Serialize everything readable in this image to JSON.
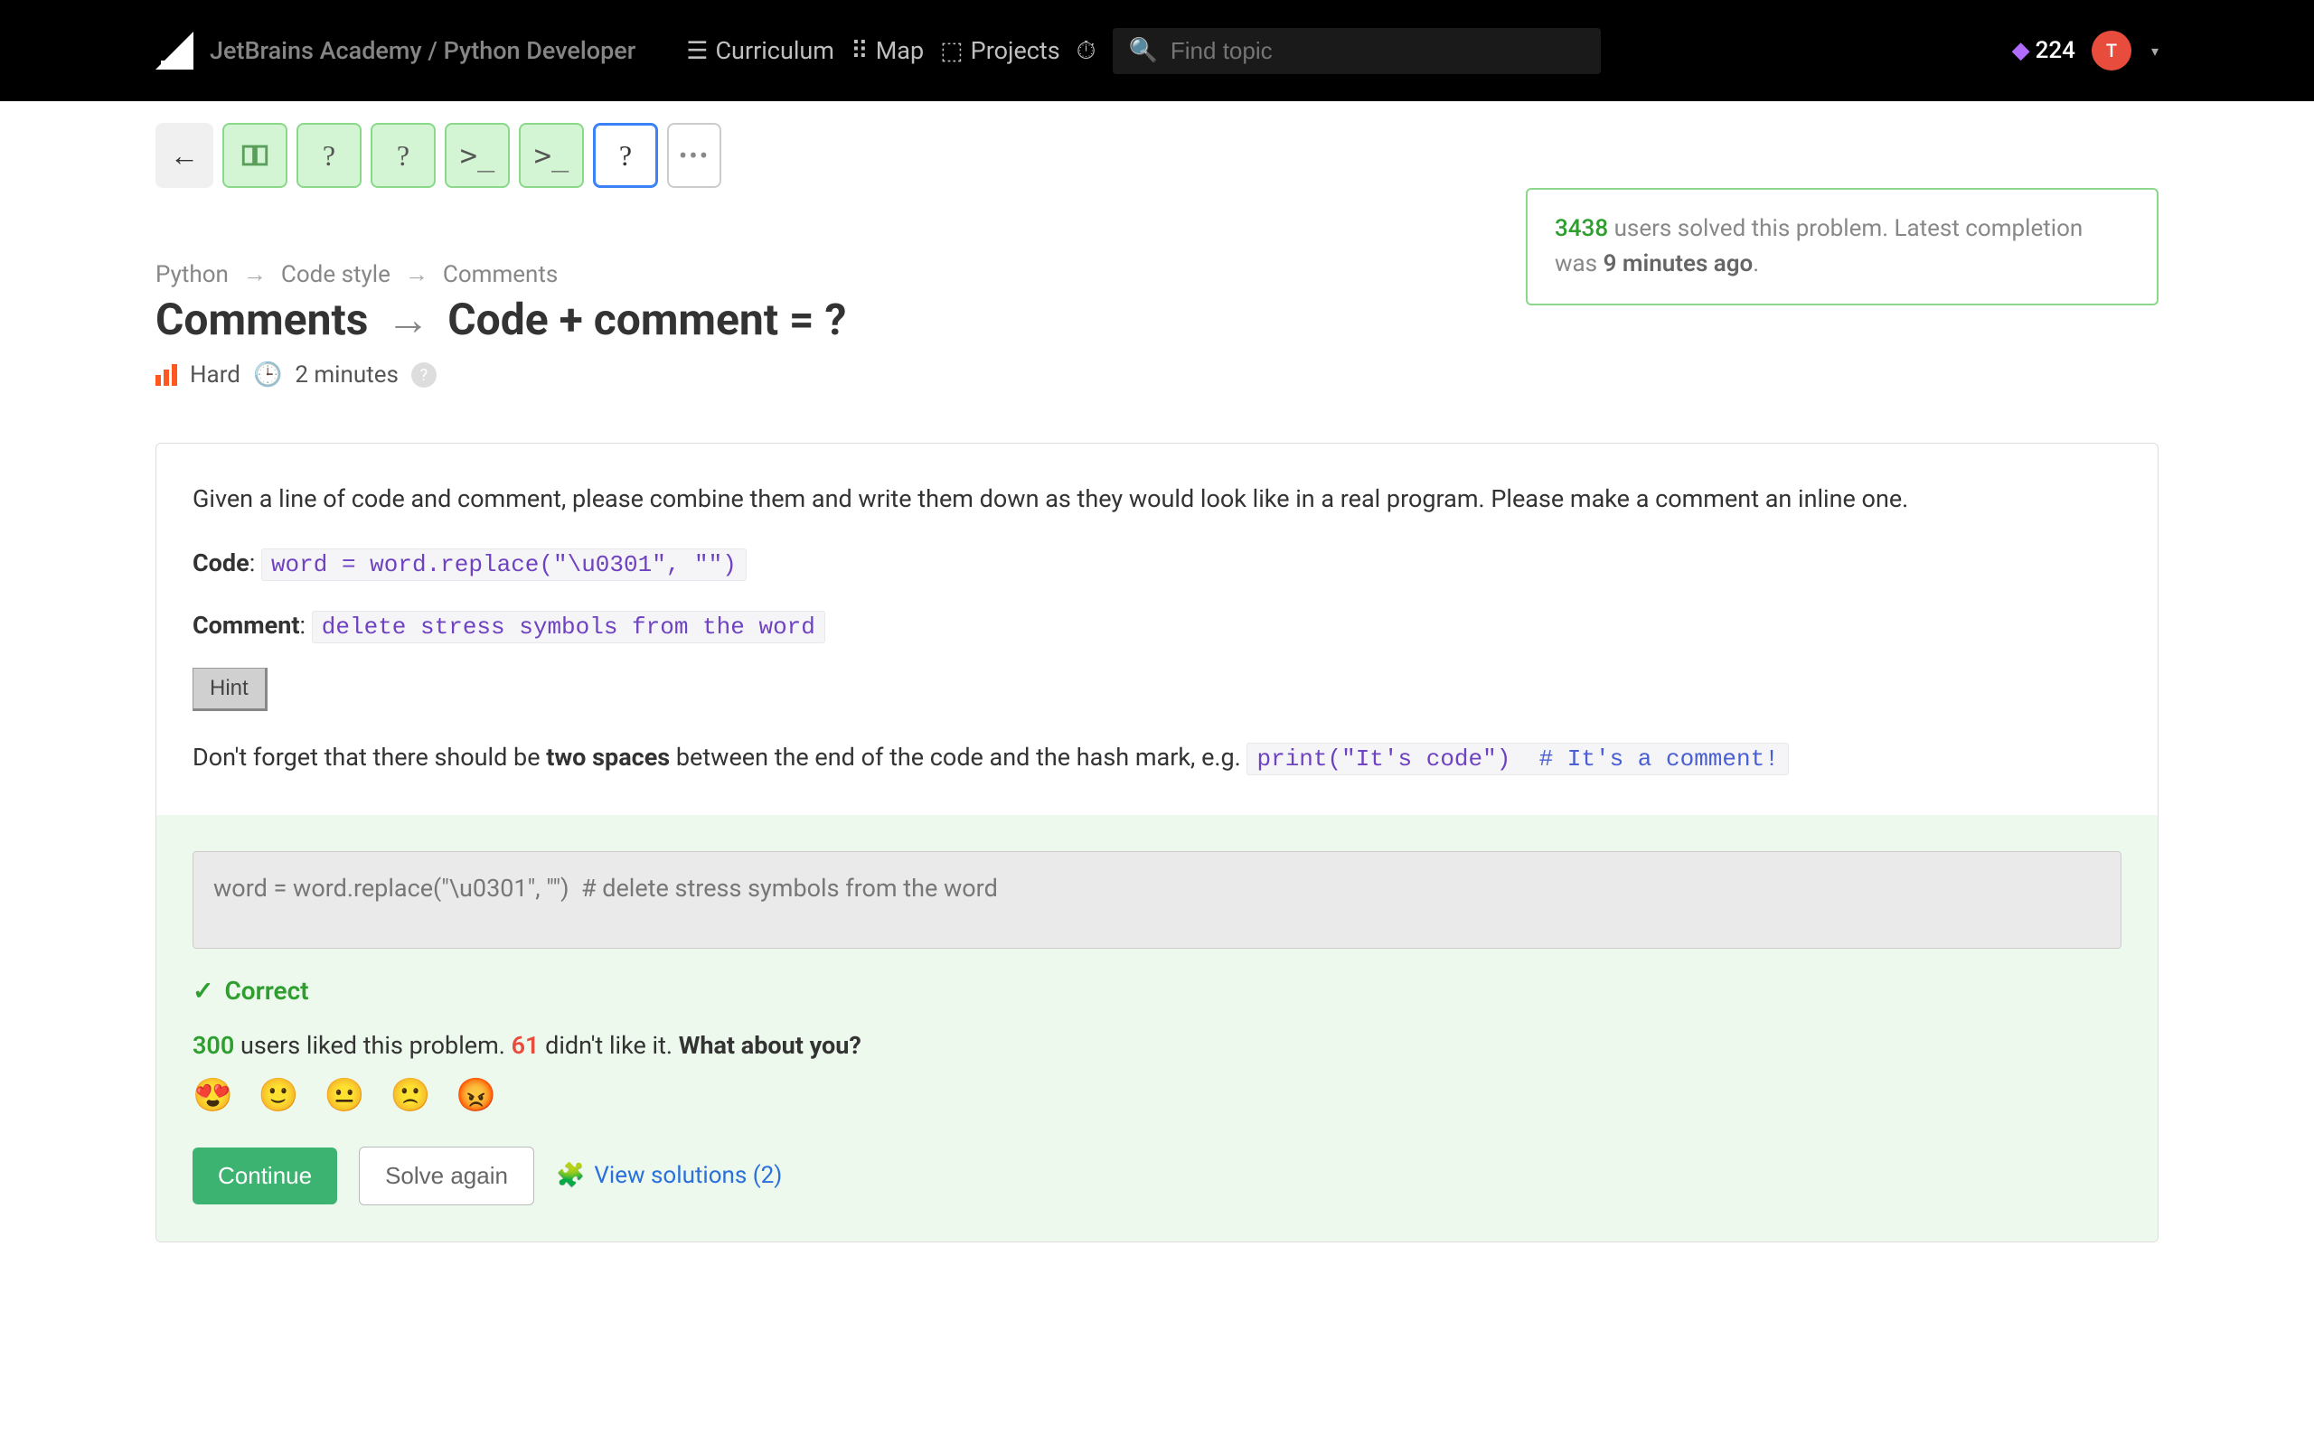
{
  "header": {
    "site": "JetBrains Academy / Python Developer",
    "nav": {
      "curriculum": "Curriculum",
      "map": "Map",
      "projects": "Projects"
    },
    "search_placeholder": "Find topic",
    "gems": "224",
    "avatar_initial": "T"
  },
  "stepper": {
    "q1": "?",
    "q2": "?",
    "p1": ">_",
    "p2": ">_",
    "q3": "?",
    "more": "•••"
  },
  "breadcrumb": {
    "a": "Python",
    "b": "Code style",
    "c": "Comments"
  },
  "title": {
    "left": "Comments",
    "right": "Code + comment = ?"
  },
  "meta": {
    "difficulty": "Hard",
    "time": "2 minutes"
  },
  "solved": {
    "count": "3438",
    "text_mid": "users solved this problem. Latest completion was",
    "ago": "9 minutes ago"
  },
  "problem": {
    "intro": "Given a line of code and comment, please combine them and write them down as they would look like in a real program. Please make a comment an inline one.",
    "code_label": "Code",
    "code_value": "word = word.replace(\"\\u0301\", \"\")",
    "comment_label": "Comment",
    "comment_value": "delete stress symbols from the word",
    "hint_label": "Hint",
    "hint_text_a": "Don't forget that there should be ",
    "hint_bold": "two spaces",
    "hint_text_b": " between the end of the code and the hash mark, e.g. ",
    "hint_code": "print(\"It's code\")",
    "hint_comment": "# It's a comment!"
  },
  "answer": {
    "value": "word = word.replace(\"\\u0301\", \"\")  # delete stress symbols from the word",
    "correct": "Correct"
  },
  "feedback": {
    "likes": "300",
    "text_a": " users liked this problem. ",
    "dislikes": "61",
    "text_b": " didn't like it. ",
    "prompt": "What about you?"
  },
  "actions": {
    "continue": "Continue",
    "solve_again": "Solve again",
    "view_solutions": "View solutions (2)"
  }
}
